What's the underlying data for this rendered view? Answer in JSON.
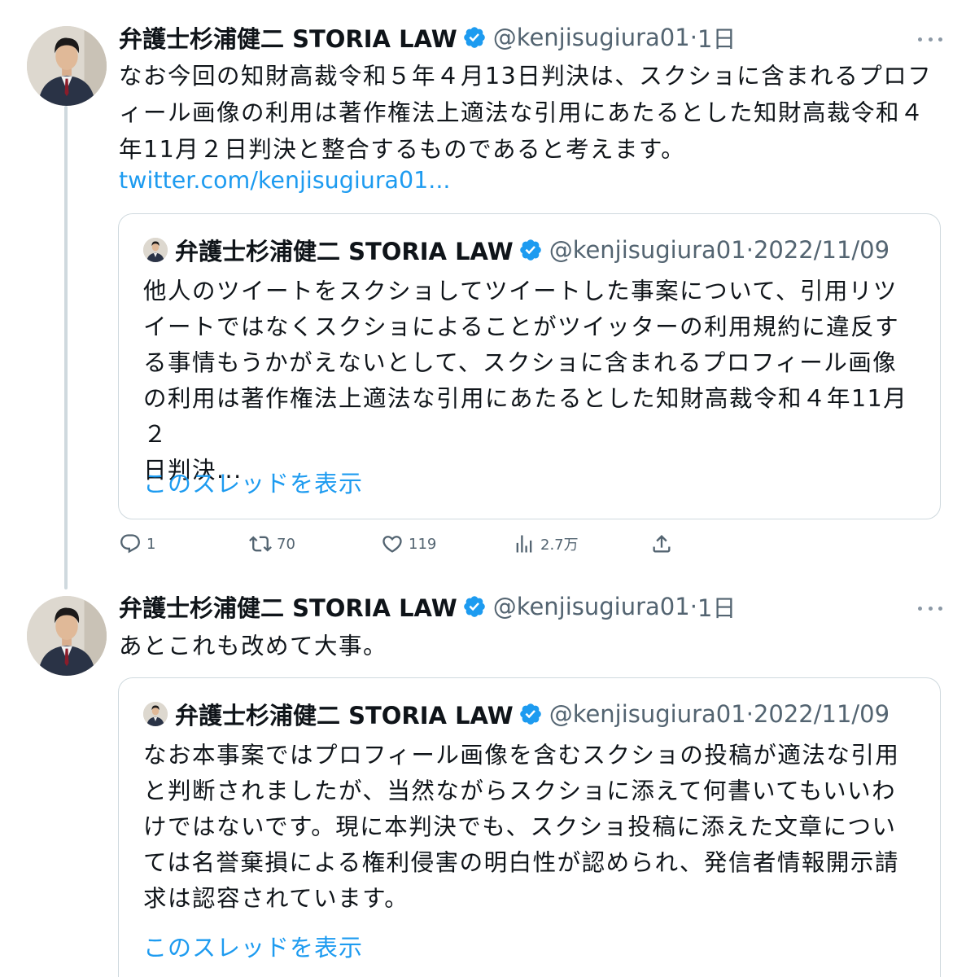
{
  "tweets": [
    {
      "author": "弁護士杉浦健二 STORIA LAW",
      "handle": "@kenjisugiura01",
      "separator": "·",
      "time": "1日",
      "text_lines": [
        "なお今回の知財高裁令和５年４月13日判決は、スクショに含まれるプロフ",
        "ィール画像の利用は著作権法上適法な引用にあたるとした知財高裁令和４",
        "年11月２日判決と整合するものであると考えます。"
      ],
      "link": "twitter.com/kenjisugiura01...",
      "quote": {
        "author": "弁護士杉浦健二 STORIA LAW",
        "handle": "@kenjisugiura01",
        "separator": "·",
        "date": "2022/11/09",
        "text_lines": [
          "他人のツイートをスクショしてツイートした事案について、引用リツ",
          "イートではなくスクショによることがツイッターの利用規約に違反す",
          "る事情もうかがえないとして、スクショに含まれるプロフィール画像",
          "の利用は著作権法上適法な引用にあたるとした知財高裁令和４年11月２",
          "日判決..."
        ],
        "show_thread": "このスレッドを表示"
      },
      "actions": {
        "reply": "1",
        "retweet": "70",
        "like": "119",
        "views": "2.7万"
      }
    },
    {
      "author": "弁護士杉浦健二 STORIA LAW",
      "handle": "@kenjisugiura01",
      "separator": "·",
      "time": "1日",
      "text_lines": [
        "あとこれも改めて大事。"
      ],
      "quote": {
        "author": "弁護士杉浦健二 STORIA LAW",
        "handle": "@kenjisugiura01",
        "separator": "·",
        "date": "2022/11/09",
        "text_lines": [
          "なお本事案ではプロフィール画像を含むスクショの投稿が適法な引用",
          "と判断されましたが、当然ながらスクショに添えて何書いてもいいわ",
          "けではないです。現に本判決でも、スクショ投稿に添えた文章につい",
          "ては名誉棄損による権利侵害の明白性が認められ、発信者情報開示請",
          "求は認容されています。"
        ],
        "show_thread": "このスレッドを表示"
      }
    }
  ],
  "colors": {
    "link": "#1d9bf0",
    "secondary_text": "#536471",
    "verified": "#1d9bf0",
    "border": "#cfd9de"
  },
  "icons": [
    "verified-badge-icon",
    "more-icon",
    "reply-icon",
    "retweet-icon",
    "like-icon",
    "views-icon",
    "share-icon"
  ]
}
